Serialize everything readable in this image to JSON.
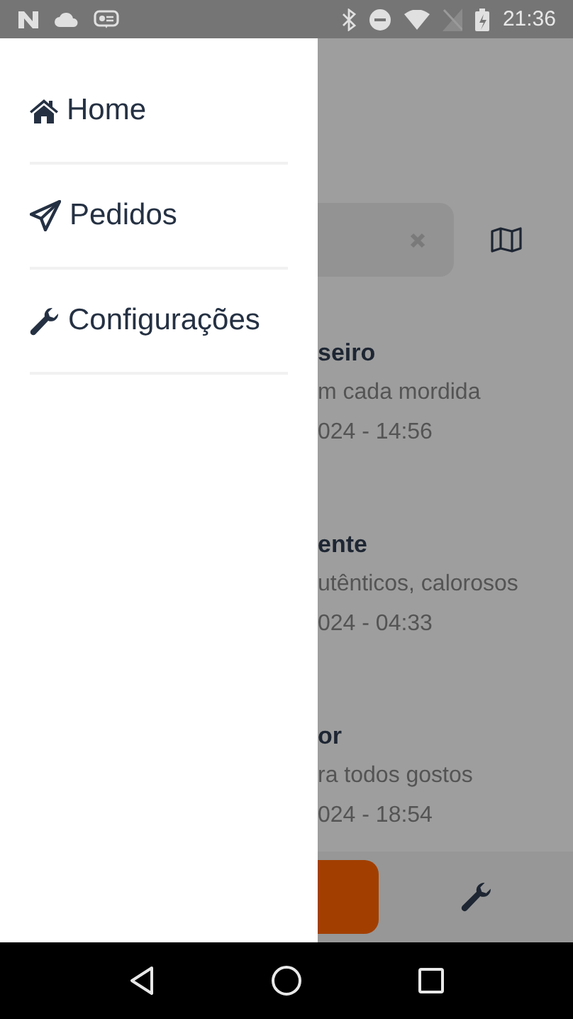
{
  "status_bar": {
    "time": "21:36"
  },
  "drawer": {
    "items": [
      {
        "label": "Home",
        "kind": "home"
      },
      {
        "label": "Pedidos",
        "kind": "send"
      },
      {
        "label": "Configurações",
        "kind": "settings"
      }
    ]
  },
  "background": {
    "cards": [
      {
        "title": "seiro",
        "description": "m cada mordida",
        "date": "024 - 14:56"
      },
      {
        "title": "ente",
        "description": "utênticos, calorosos",
        "date": "024 - 04:33"
      },
      {
        "title": "or",
        "description": "ra todos gostos",
        "date": "024 - 18:54"
      }
    ]
  }
}
